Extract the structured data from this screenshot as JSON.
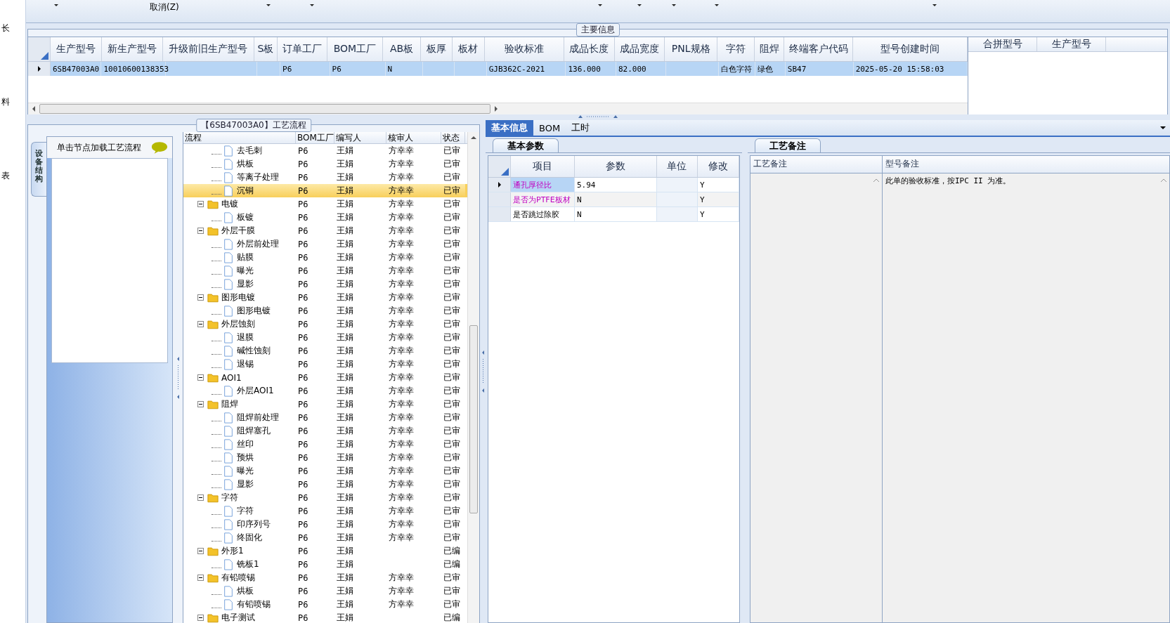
{
  "left_strip": [
    "长",
    "料",
    "表"
  ],
  "toolbar": {
    "cancel_label": "取消(Z)"
  },
  "main_info": {
    "title": "主要信息",
    "columns": [
      "生产型号",
      "新生产型号",
      "升级前旧生产型号",
      "S板",
      "订单工厂",
      "BOM工厂",
      "AB板",
      "板厚",
      "板材",
      "验收标准",
      "成品长度",
      "成品宽度",
      "PNL规格",
      "字符",
      "阻焊",
      "终端客户代码",
      "型号创建时间"
    ],
    "rows": [
      {
        "selected": true,
        "cells": [
          "6SB47003A0",
          "10010600138353",
          "",
          "",
          "P6",
          "P6",
          "N",
          "",
          "",
          "GJB362C-2021",
          "136.000",
          "82.000",
          "",
          "白色字符",
          "绿色",
          "SB47",
          "2025-05-20 15:58:03"
        ]
      }
    ],
    "merge_columns": [
      "合拼型号",
      "生产型号"
    ]
  },
  "process": {
    "title": "【6SB47003A0】工艺流程",
    "side_tab": "设备结构",
    "hint": "单击节点加载工艺流程",
    "columns": [
      "流程",
      "BOM工厂",
      "编写人",
      "核审人",
      "状态"
    ],
    "tree": [
      {
        "children": [
          {
            "label": "去毛刺",
            "bom": "P6",
            "writer": "王娟",
            "reviewer": "方幸幸",
            "status": "已审",
            "selected": false
          },
          {
            "label": "烘板",
            "bom": "P6",
            "writer": "王娟",
            "reviewer": "方幸幸",
            "status": "已审",
            "selected": false
          },
          {
            "label": "等离子处理",
            "bom": "P6",
            "writer": "王娟",
            "reviewer": "方幸幸",
            "status": "已审",
            "selected": false
          },
          {
            "label": "沉铜",
            "bom": "P6",
            "writer": "王娟",
            "reviewer": "方幸幸",
            "status": "已审",
            "selected": true
          }
        ]
      },
      {
        "label": "电镀",
        "bom": "P6",
        "writer": "王娟",
        "reviewer": "方幸幸",
        "status": "已审",
        "selected": false,
        "expanded": true,
        "children": [
          {
            "label": "板镀",
            "bom": "P6",
            "writer": "王娟",
            "reviewer": "方幸幸",
            "status": "已审",
            "selected": false
          }
        ]
      },
      {
        "label": "外层干膜",
        "bom": "P6",
        "writer": "王娟",
        "reviewer": "方幸幸",
        "status": "已审",
        "selected": false,
        "expanded": true,
        "children": [
          {
            "label": "外层前处理",
            "bom": "P6",
            "writer": "王娟",
            "reviewer": "方幸幸",
            "status": "已审",
            "selected": false
          },
          {
            "label": "贴膜",
            "bom": "P6",
            "writer": "王娟",
            "reviewer": "方幸幸",
            "status": "已审",
            "selected": false
          },
          {
            "label": "曝光",
            "bom": "P6",
            "writer": "王娟",
            "reviewer": "方幸幸",
            "status": "已审",
            "selected": false
          },
          {
            "label": "显影",
            "bom": "P6",
            "writer": "王娟",
            "reviewer": "方幸幸",
            "status": "已审",
            "selected": false
          }
        ]
      },
      {
        "label": "图形电镀",
        "bom": "P6",
        "writer": "王娟",
        "reviewer": "方幸幸",
        "status": "已审",
        "selected": false,
        "expanded": true,
        "children": [
          {
            "label": "图形电镀",
            "bom": "P6",
            "writer": "王娟",
            "reviewer": "方幸幸",
            "status": "已审",
            "selected": false
          }
        ]
      },
      {
        "label": "外层蚀刻",
        "bom": "P6",
        "writer": "王娟",
        "reviewer": "方幸幸",
        "status": "已审",
        "selected": false,
        "expanded": true,
        "children": [
          {
            "label": "退膜",
            "bom": "P6",
            "writer": "王娟",
            "reviewer": "方幸幸",
            "status": "已审",
            "selected": false
          },
          {
            "label": "碱性蚀刻",
            "bom": "P6",
            "writer": "王娟",
            "reviewer": "方幸幸",
            "status": "已审",
            "selected": false
          },
          {
            "label": "退锡",
            "bom": "P6",
            "writer": "王娟",
            "reviewer": "方幸幸",
            "status": "已审",
            "selected": false
          }
        ]
      },
      {
        "label": "AOI1",
        "bom": "P6",
        "writer": "王娟",
        "reviewer": "方幸幸",
        "status": "已审",
        "selected": false,
        "expanded": true,
        "children": [
          {
            "label": "外层AOI1",
            "bom": "P6",
            "writer": "王娟",
            "reviewer": "方幸幸",
            "status": "已审",
            "selected": false
          }
        ]
      },
      {
        "label": "阻焊",
        "bom": "P6",
        "writer": "王娟",
        "reviewer": "方幸幸",
        "status": "已审",
        "selected": false,
        "expanded": true,
        "children": [
          {
            "label": "阻焊前处理",
            "bom": "P6",
            "writer": "王娟",
            "reviewer": "方幸幸",
            "status": "已审",
            "selected": false
          },
          {
            "label": "阻焊塞孔",
            "bom": "P6",
            "writer": "王娟",
            "reviewer": "方幸幸",
            "status": "已审",
            "selected": false
          },
          {
            "label": "丝印",
            "bom": "P6",
            "writer": "王娟",
            "reviewer": "方幸幸",
            "status": "已审",
            "selected": false
          },
          {
            "label": "预烘",
            "bom": "P6",
            "writer": "王娟",
            "reviewer": "方幸幸",
            "status": "已审",
            "selected": false
          },
          {
            "label": "曝光",
            "bom": "P6",
            "writer": "王娟",
            "reviewer": "方幸幸",
            "status": "已审",
            "selected": false
          },
          {
            "label": "显影",
            "bom": "P6",
            "writer": "王娟",
            "reviewer": "方幸幸",
            "status": "已审",
            "selected": false
          }
        ]
      },
      {
        "label": "字符",
        "bom": "P6",
        "writer": "王娟",
        "reviewer": "方幸幸",
        "status": "已审",
        "selected": false,
        "expanded": true,
        "children": [
          {
            "label": "字符",
            "bom": "P6",
            "writer": "王娟",
            "reviewer": "方幸幸",
            "status": "已审",
            "selected": false
          },
          {
            "label": "印序列号",
            "bom": "P6",
            "writer": "王娟",
            "reviewer": "方幸幸",
            "status": "已审",
            "selected": false
          },
          {
            "label": "终固化",
            "bom": "P6",
            "writer": "王娟",
            "reviewer": "方幸幸",
            "status": "已审",
            "selected": false
          }
        ]
      },
      {
        "label": "外形1",
        "bom": "P6",
        "writer": "王娟",
        "status": "已编",
        "selected": false,
        "expanded": true,
        "children": [
          {
            "label": "铣板1",
            "bom": "P6",
            "writer": "王娟",
            "status": "已编",
            "selected": false
          }
        ]
      },
      {
        "label": "有铅喷锡",
        "bom": "P6",
        "writer": "王娟",
        "reviewer": "方幸幸",
        "status": "已审",
        "selected": false,
        "expanded": true,
        "children": [
          {
            "label": "烘板",
            "bom": "P6",
            "writer": "王娟",
            "reviewer": "方幸幸",
            "status": "已审",
            "selected": false
          },
          {
            "label": "有铅喷锡",
            "bom": "P6",
            "writer": "王娟",
            "reviewer": "方幸幸",
            "status": "已审",
            "selected": false
          }
        ]
      },
      {
        "label": "电子测试",
        "bom": "P6",
        "writer": "王娟",
        "status": "已编",
        "selected": false,
        "expanded": true
      }
    ]
  },
  "detail_tabs": [
    {
      "label": "基本信息",
      "selected": true
    },
    {
      "label": "BOM",
      "selected": false
    },
    {
      "label": "工时",
      "selected": false
    }
  ],
  "params": {
    "tab": "基本参数",
    "columns": [
      "项目",
      "参数",
      "单位",
      "修改"
    ],
    "rows": [
      {
        "selected": true,
        "highlighted": true,
        "cells": [
          "通孔厚径比",
          "5.94",
          "",
          "Y"
        ]
      },
      {
        "selected": false,
        "highlighted": true,
        "cells": [
          "是否为PTFE板材",
          "N",
          "",
          "Y"
        ]
      },
      {
        "selected": false,
        "highlighted": false,
        "cells": [
          "是否跳过除胶",
          "N",
          "",
          "Y"
        ]
      }
    ]
  },
  "notes": {
    "tab": "工艺备注",
    "columns": [
      "工艺备注",
      "型号备注"
    ],
    "model_note": "此单的验收标准，按IPC II 为准。"
  }
}
